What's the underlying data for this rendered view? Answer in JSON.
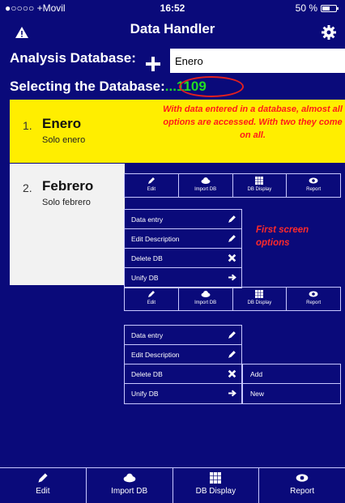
{
  "status_bar": {
    "carrier": "●○○○○ +Movil ",
    "time": "16:52",
    "battery": "50 %"
  },
  "nav": {
    "title": "Data Handler",
    "left_icon": "warning-icon",
    "right_icon": "gear-icon"
  },
  "analysis": {
    "label": "Analysis Database:",
    "input_value": "Enero"
  },
  "selecting": {
    "label": "Selecting the Database:",
    "value": "...1109",
    "highlight_color": "#22dd22"
  },
  "rows": [
    {
      "num": "1.",
      "name": "Enero",
      "desc": "Solo enero",
      "color": "#ffee00"
    },
    {
      "num": "2.",
      "name": "Febrero",
      "desc": "Solo febrero",
      "color": "#f2f2f2"
    }
  ],
  "notes": {
    "note1": "With data entered in a database, almost all options are accessed. With two they come on all.",
    "note2": "First screen options"
  },
  "mini_toolbar": [
    {
      "label": "Edit",
      "icon": "pencil-icon"
    },
    {
      "label": "Import DB",
      "icon": "cloud-icon"
    },
    {
      "label": "DB Display",
      "icon": "grid-icon"
    },
    {
      "label": "Report",
      "icon": "eye-icon"
    }
  ],
  "menu_a": [
    {
      "label": "Data entry",
      "icon": "pencil-icon"
    },
    {
      "label": "Edit Description",
      "icon": "pencil-icon"
    },
    {
      "label": "Delete DB",
      "icon": "close-icon"
    },
    {
      "label": "Unify DB",
      "icon": "arrow-right-icon"
    }
  ],
  "menu_b": [
    {
      "label": "Data entry",
      "icon": "pencil-icon"
    },
    {
      "label": "Edit Description",
      "icon": "pencil-icon"
    },
    {
      "label": "Delete DB",
      "icon": "close-icon"
    },
    {
      "label": "Unify DB",
      "icon": "arrow-right-icon"
    }
  ],
  "submenu": [
    {
      "label": "Add"
    },
    {
      "label": "New"
    }
  ],
  "tabbar": [
    {
      "label": "Edit",
      "icon": "pencil-icon"
    },
    {
      "label": "Import DB",
      "icon": "cloud-icon"
    },
    {
      "label": "DB Display",
      "icon": "grid-icon"
    },
    {
      "label": "Report",
      "icon": "eye-icon"
    }
  ],
  "colors": {
    "background": "#0a0a7a",
    "note_red": "#ff1a1a",
    "oval_red": "#e02020"
  }
}
